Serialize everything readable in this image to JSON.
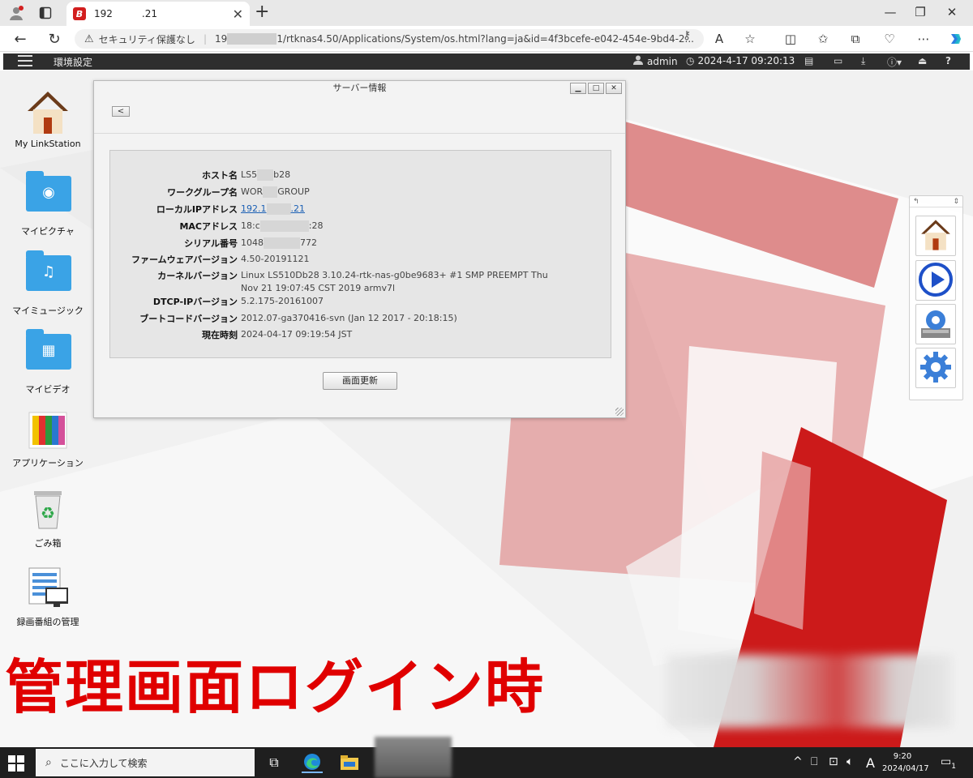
{
  "browser": {
    "tab_title": "192   .21",
    "security_label": "セキュリティ保護なし",
    "url_prefix": "19",
    "url_rest": "1/rtknas4.50/Applications/System/os.html?lang=ja&id=4f3bcefe-e042-454e-9bd4-2...",
    "favicon_letter": "B"
  },
  "appbar": {
    "title": "環境設定",
    "user": "admin",
    "datetime": "2024-4-17 09:20:13"
  },
  "desktop_icons": [
    {
      "label": "My LinkStation",
      "icon": "home-icon"
    },
    {
      "label": "マイピクチャ",
      "icon": "camera-folder-icon"
    },
    {
      "label": "マイミュージック",
      "icon": "music-folder-icon"
    },
    {
      "label": "マイビデオ",
      "icon": "video-folder-icon"
    },
    {
      "label": "アプリケーション",
      "icon": "applications-icon"
    },
    {
      "label": "ごみ箱",
      "icon": "recycle-bin-icon"
    },
    {
      "label": "録画番組の管理",
      "icon": "recording-manager-icon"
    }
  ],
  "window": {
    "title": "サーバー情報",
    "back_label": "<",
    "refresh_label": "画面更新",
    "rows": [
      {
        "label": "ホスト名",
        "v1": "LS5",
        "v2": "b28"
      },
      {
        "label": "ワークグループ名",
        "v1": "WOR",
        "v2": "GROUP"
      },
      {
        "label": "ローカルIPアドレス",
        "v1": "192.1",
        "v2": ".21"
      },
      {
        "label": "MACアドレス",
        "v1": "18:c",
        "v2": ":28"
      },
      {
        "label": "シリアル番号",
        "v1": "1048",
        "v2": "772"
      },
      {
        "label": "ファームウェアバージョン",
        "v1": "4.50-20191121",
        "v2": ""
      },
      {
        "label": "カーネルバージョン",
        "v1": "Linux LS510Db28 3.10.24-rtk-nas-g0be9683+ #1 SMP PREEMPT Thu Nov 21 19:07:45 CST 2019 armv7l",
        "v2": ""
      },
      {
        "label": "DTCP-IPバージョン",
        "v1": "5.2.175-20161007",
        "v2": ""
      },
      {
        "label": "ブートコードバージョン",
        "v1": "2012.07-ga370416-svn (Jan 12 2017 - 20:18:15)",
        "v2": ""
      },
      {
        "label": "現在時刻",
        "v1": "2024-04-17 09:19:54 JST",
        "v2": ""
      }
    ]
  },
  "dock": {
    "items": [
      "home-icon",
      "play-icon",
      "disk-settings-icon",
      "settings-gear-icon"
    ]
  },
  "caption": "管理画面ログイン時",
  "taskbar": {
    "search_placeholder": "ここに入力して検索",
    "ime": "A",
    "time": "9:20",
    "date": "2024/04/17",
    "notification_count": "1"
  },
  "colors": {
    "accent_red": "#d32020",
    "caption_red": "#e00000",
    "appbar": "#2e2e2e",
    "link_blue": "#1a5fb4"
  }
}
